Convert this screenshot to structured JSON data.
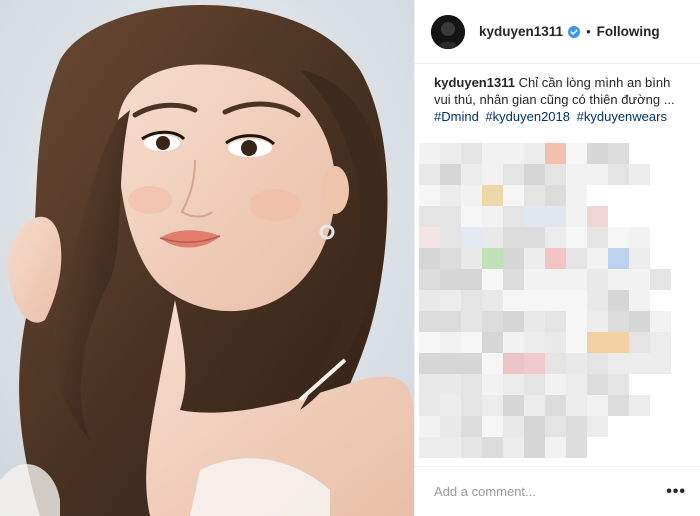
{
  "post": {
    "username": "kyduyen1311",
    "follow_separator": "•",
    "follow_status": "Following",
    "verified": true
  },
  "caption": {
    "username": "kyduyen1311",
    "text": "Chỉ cần lòng mình an bình vui thú, nhân gian cũng có thiên đường ...",
    "hashtags": [
      "#Dmind",
      "#kyduyen2018",
      "#kyduyenwears"
    ]
  },
  "comment_box": {
    "placeholder": "Add a comment...",
    "more_label": "•••"
  },
  "colors": {
    "verified_blue": "#3897f0",
    "hashtag": "#003569",
    "text": "#262626",
    "muted": "#999999",
    "divider": "#efefef"
  },
  "icons": {
    "verified": "verified-badge-icon",
    "more": "more-options-icon"
  }
}
